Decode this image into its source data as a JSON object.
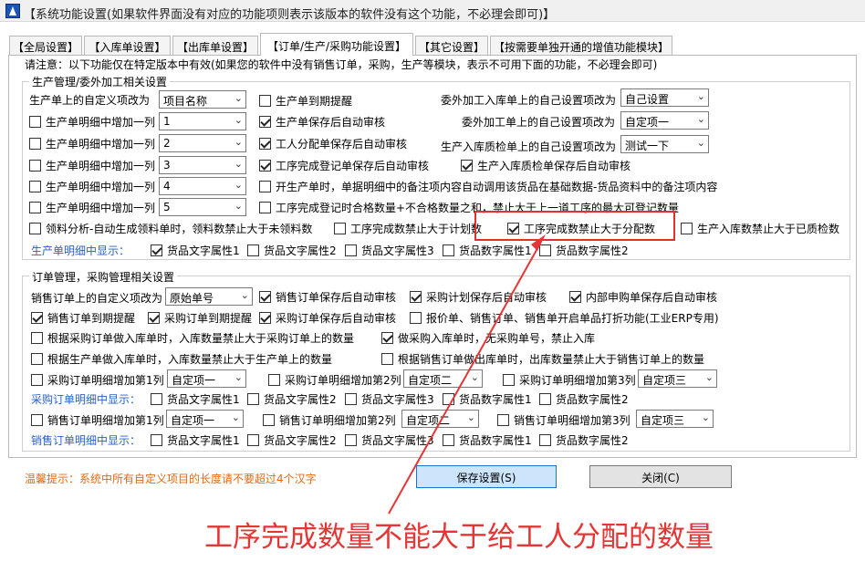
{
  "window": {
    "title": "【系统功能设置(如果软件界面没有对应的功能项则表示该版本的软件没有这个功能，不必理会即可)】"
  },
  "tabs": [
    {
      "label": "【全局设置】"
    },
    {
      "label": "【入库单设置】"
    },
    {
      "label": "【出库单设置】"
    },
    {
      "label": "【订单/生产/采购功能设置】"
    },
    {
      "label": "【其它设置】"
    },
    {
      "label": "【按需要单独开通的增值功能模块】"
    }
  ],
  "notice": "请注意：以下功能仅在特定版本中有效(如果您的软件中没有销售订单，采购，生产等模块，表示不可用下面的功能，不必理会即可)",
  "production": {
    "legend": "生产管理/委外加工相关设置",
    "custom_label": "生产单上的自定义项改为",
    "custom_value": "项目名称",
    "add_col_label": "生产单明细中增加一列",
    "add_cols": [
      {
        "value": "1",
        "checked": false
      },
      {
        "value": "2",
        "checked": false
      },
      {
        "value": "3",
        "checked": false
      },
      {
        "value": "4",
        "checked": false
      },
      {
        "value": "5",
        "checked": false
      }
    ],
    "mid": [
      {
        "label": "生产单到期提醒",
        "checked": false
      },
      {
        "label": "生产单保存后自动审核",
        "checked": true
      },
      {
        "label": "工人分配单保存后自动审核",
        "checked": true
      },
      {
        "label": "工序完成登记单保存后自动审核",
        "checked": true
      },
      {
        "label": "开生产单时，单据明细中的备注项内容自动调用该货品在基础数据-货品资料中的备注项内容",
        "checked": false
      },
      {
        "label": "工序完成登记时合格数量+不合格数量之和，禁止大于上一道工序的最大可登记数量",
        "checked": false
      }
    ],
    "outsource": [
      {
        "label": "委外加工入库单上的自己设置项改为",
        "value": "自己设置"
      },
      {
        "label": "委外加工单上的自己设置项改为",
        "value": "自定项一"
      },
      {
        "label": "生产入库质检单上的自己设置项改为",
        "value": "测试一下"
      }
    ],
    "qc_auto": {
      "label": "生产入库质检单保存后自动审核",
      "checked": true
    },
    "bottom_row": [
      {
        "label": "领料分析-自动生成领料单时，领料数禁止大于未领料数",
        "checked": false
      },
      {
        "label": "工序完成数禁止大于计划数",
        "checked": false
      },
      {
        "label": "工序完成数禁止大于分配数",
        "checked": true
      },
      {
        "label": "生产入库数禁止大于已质检数",
        "checked": false
      }
    ],
    "detail_label": "生产单明细中显示：",
    "detail_items": [
      {
        "label": "货品文字属性1",
        "checked": true
      },
      {
        "label": "货品文字属性2",
        "checked": false
      },
      {
        "label": "货品文字属性3",
        "checked": false
      },
      {
        "label": "货品数字属性1",
        "checked": false
      },
      {
        "label": "货品数字属性2",
        "checked": false
      }
    ]
  },
  "orders": {
    "legend": "订单管理，采购管理相关设置",
    "sales_custom_label": "销售订单上的自定义项改为",
    "sales_custom_value": "原始单号",
    "row1": [
      {
        "label": "销售订单保存后自动审核",
        "checked": true
      },
      {
        "label": "采购计划保存后自动审核",
        "checked": true
      },
      {
        "label": "内部申购单保存后自动审核",
        "checked": true
      }
    ],
    "row2": [
      {
        "label": "销售订单到期提醒",
        "checked": true
      },
      {
        "label": "采购订单到期提醒",
        "checked": true
      },
      {
        "label": "采购订单保存后自动审核",
        "checked": true
      },
      {
        "label": "报价单、销售订单、销售单开启单品打折功能(工业ERP专用)",
        "checked": false
      }
    ],
    "row3": [
      {
        "label": "根据采购订单做入库单时，入库数量禁止大于采购订单上的数量",
        "checked": false
      },
      {
        "label": "做采购入库单时，无采购单号，禁止入库",
        "checked": true
      }
    ],
    "row4": [
      {
        "label": "根据生产单做入库单时，入库数量禁止大于生产单上的数量",
        "checked": false
      },
      {
        "label": "根据销售订单做出库单时，出库数量禁止大于销售订单上的数量",
        "checked": false
      }
    ],
    "purchase_cols": [
      {
        "label": "采购订单明细增加第1列",
        "value": "自定项一",
        "checked": false
      },
      {
        "label": "采购订单明细增加第2列",
        "value": "自定项二",
        "checked": false
      },
      {
        "label": "采购订单明细增加第3列",
        "value": "自定项三",
        "checked": false
      }
    ],
    "purchase_detail_label": "采购订单明细中显示：",
    "purchase_detail_items": [
      {
        "label": "货品文字属性1",
        "checked": false
      },
      {
        "label": "货品文字属性2",
        "checked": false
      },
      {
        "label": "货品文字属性3",
        "checked": false
      },
      {
        "label": "货品数字属性1",
        "checked": false
      },
      {
        "label": "货品数字属性2",
        "checked": false
      }
    ],
    "sales_cols": [
      {
        "label": "销售订单明细增加第1列",
        "value": "自定项一",
        "checked": false
      },
      {
        "label": "销售订单明细增加第2列",
        "value": "自定项二",
        "checked": false
      },
      {
        "label": "销售订单明细增加第3列",
        "value": "自定项三",
        "checked": false
      }
    ],
    "sales_detail_label": "销售订单明细中显示：",
    "sales_detail_items": [
      {
        "label": "货品文字属性1",
        "checked": false
      },
      {
        "label": "货品文字属性2",
        "checked": false
      },
      {
        "label": "货品文字属性3",
        "checked": false
      },
      {
        "label": "货品数字属性1",
        "checked": false
      },
      {
        "label": "货品数字属性2",
        "checked": false
      }
    ]
  },
  "footer": {
    "tip": "温馨提示：系统中所有自定义项目的长度请不要超过4个汉字",
    "save_label": "保存设置(S)",
    "close_label": "关闭(C)"
  },
  "annotation": {
    "text": "工序完成数量不能大于给工人分配的数量"
  },
  "colors": {
    "annotation": "#e53535",
    "highlight": "#e23030",
    "hint_blue": "#2a62c7",
    "tip_orange": "#e36a14"
  }
}
